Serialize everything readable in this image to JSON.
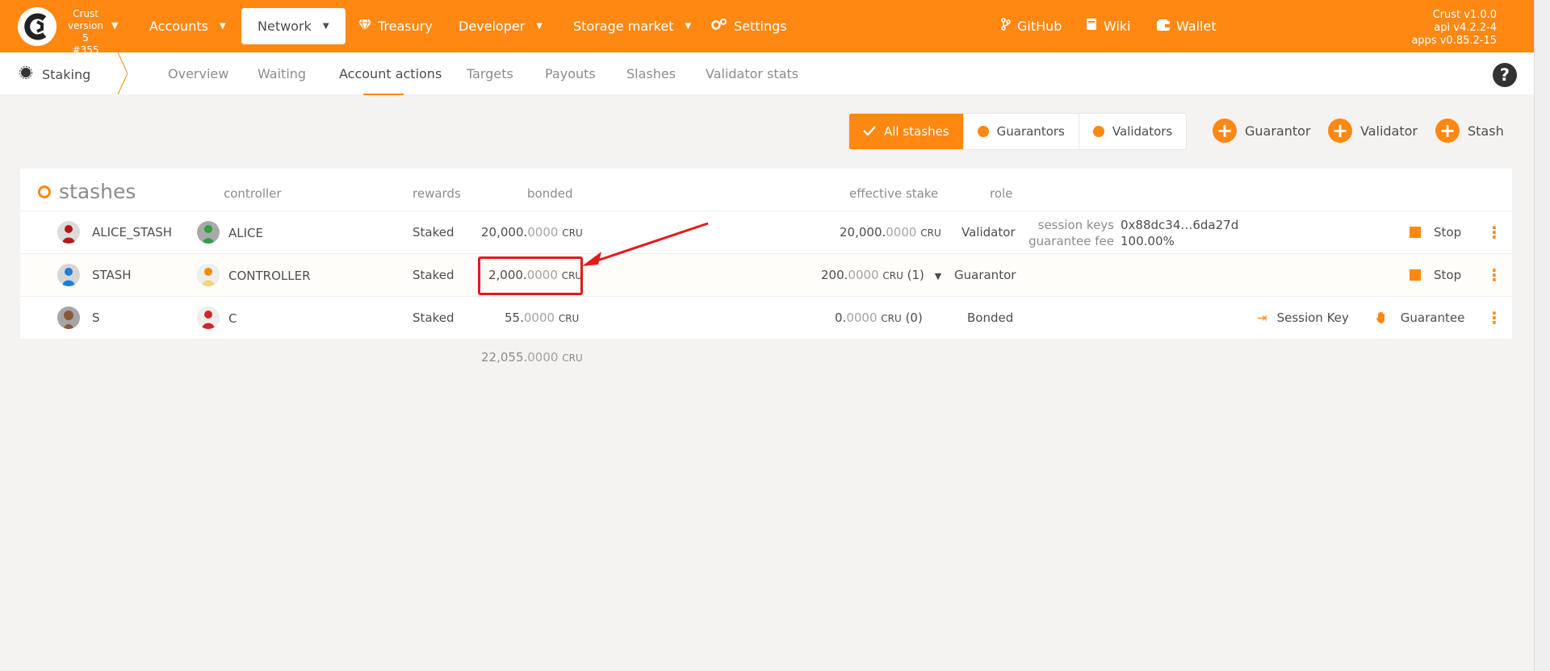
{
  "app": {
    "chain_name": "Crust",
    "chain_version": "version 5",
    "block": "#355",
    "version_lines": [
      "Crust v1.0.0",
      "api v4.2.2-4",
      "apps v0.85.2-15"
    ]
  },
  "nav": {
    "accounts": "Accounts",
    "network": "Network",
    "treasury": "Treasury",
    "developer": "Developer",
    "storage_market": "Storage market",
    "settings": "Settings",
    "github": "GitHub",
    "wiki": "Wiki",
    "wallet": "Wallet"
  },
  "subnav": {
    "section": "Staking",
    "tabs": [
      "Overview",
      "Waiting",
      "Account actions",
      "Targets",
      "Payouts",
      "Slashes",
      "Validator stats"
    ],
    "active_tab": "Account actions"
  },
  "filters": {
    "all_stashes": "All stashes",
    "guarantors": "Guarantors",
    "validators": "Validators"
  },
  "actions": {
    "guarantor": "Guarantor",
    "validator": "Validator",
    "stash": "Stash"
  },
  "table": {
    "title": "stashes",
    "headers": {
      "controller": "controller",
      "rewards": "rewards",
      "bonded": "bonded",
      "effective_stake": "effective stake",
      "role": "role"
    },
    "unit": "CRU",
    "rows": [
      {
        "stash": "ALICE_STASH",
        "controller": "ALICE",
        "rewards": "Staked",
        "bonded_int": "20,000.",
        "bonded_dec": "0000",
        "effective_int": "20,000.",
        "effective_dec": "0000",
        "effective_extra": "",
        "role": "Validator",
        "session_keys_label": "session keys",
        "session_keys": "0x88dc34…6da27d",
        "guarantee_fee_label": "guarantee fee",
        "guarantee_fee": "100.00%",
        "action": "Stop"
      },
      {
        "stash": "STASH",
        "controller": "CONTROLLER",
        "rewards": "Staked",
        "bonded_int": "2,000.",
        "bonded_dec": "0000",
        "effective_int": "200.",
        "effective_dec": "0000",
        "effective_extra": "(1)",
        "role": "Guarantor",
        "action": "Stop"
      },
      {
        "stash": "S",
        "controller": "C",
        "rewards": "Staked",
        "bonded_int": "55.",
        "bonded_dec": "0000",
        "effective_int": "0.",
        "effective_dec": "0000",
        "effective_extra": "(0)",
        "role": "Bonded",
        "action_session_key": "Session Key",
        "action_guarantee": "Guarantee"
      }
    ],
    "total_int": "22,055.",
    "total_dec": "0000"
  },
  "colors": {
    "brand": "#ff8812",
    "annotation": "#e31a1a"
  }
}
